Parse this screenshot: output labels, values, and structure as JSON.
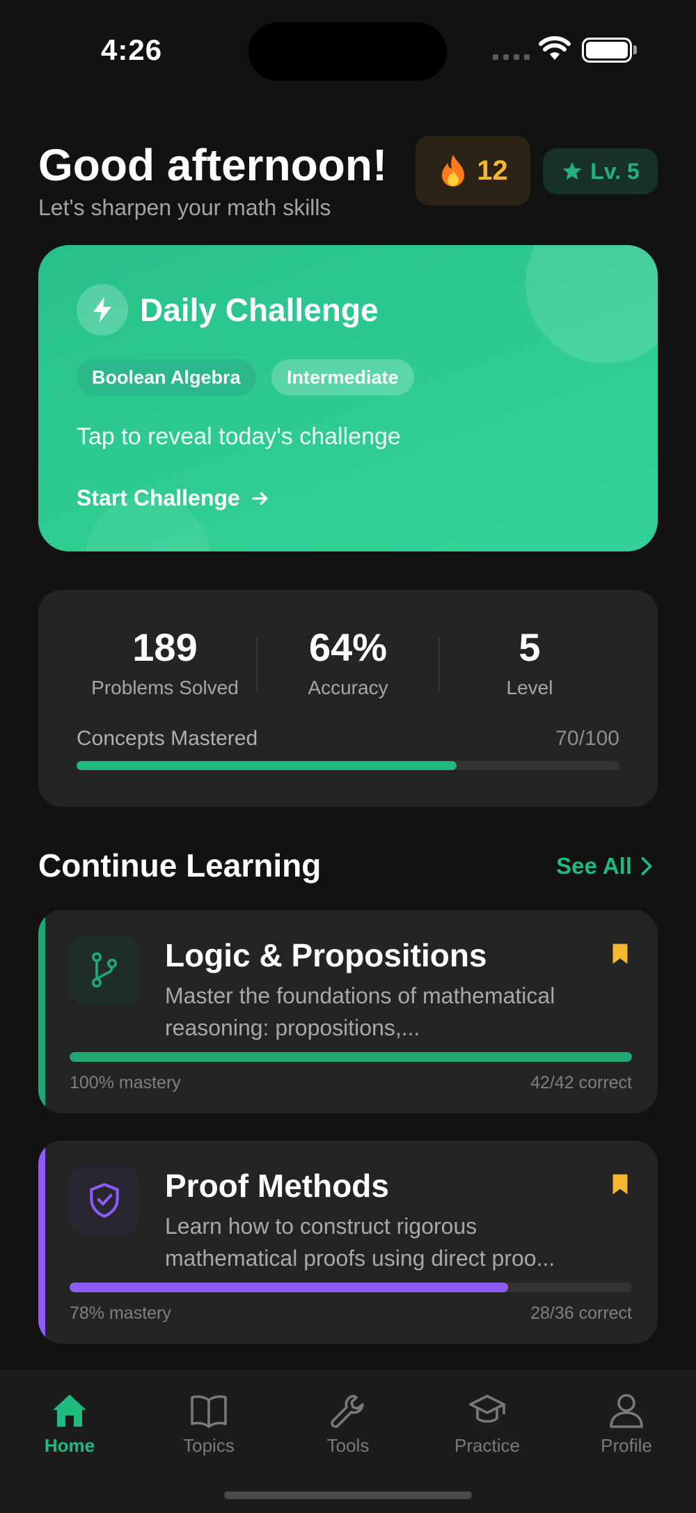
{
  "status": {
    "time": "4:26"
  },
  "header": {
    "greeting": "Good afternoon!",
    "subtitle": "Let's sharpen your math skills",
    "streak": {
      "icon": "fire-icon",
      "value": "12"
    },
    "level": {
      "icon": "star-icon",
      "label": "Lv. 5"
    }
  },
  "challenge": {
    "icon": "lightning-icon",
    "title": "Daily Challenge",
    "topic": "Boolean Algebra",
    "difficulty": "Intermediate",
    "prompt": "Tap to reveal today's challenge",
    "cta": "Start Challenge"
  },
  "stats": {
    "items": [
      {
        "value": "189",
        "label": "Problems Solved"
      },
      {
        "value": "64%",
        "label": "Accuracy"
      },
      {
        "value": "5",
        "label": "Level"
      }
    ],
    "concepts_label": "Concepts Mastered",
    "concepts_count": "70/100",
    "concepts_progress": 0.7
  },
  "continue_learning": {
    "title": "Continue Learning",
    "see_all": "See All",
    "courses": [
      {
        "icon": "branch-icon",
        "title": "Logic & Propositions",
        "description": "Master the foundations of mathematical reasoning: propositions,...",
        "mastery": "100% mastery",
        "correct": "42/42 correct",
        "progress": 1.0,
        "color": "#1fa874"
      },
      {
        "icon": "shield-check-icon",
        "title": "Proof Methods",
        "description": "Learn how to construct rigorous mathematical proofs using direct proo...",
        "mastery": "78% mastery",
        "correct": "28/36 correct",
        "progress": 0.78,
        "color": "#8b5cf6"
      }
    ]
  },
  "tabs": [
    {
      "label": "Home",
      "icon": "home-icon",
      "active": true
    },
    {
      "label": "Topics",
      "icon": "book-icon",
      "active": false
    },
    {
      "label": "Tools",
      "icon": "wrench-icon",
      "active": false
    },
    {
      "label": "Practice",
      "icon": "graduation-cap-icon",
      "active": false
    },
    {
      "label": "Profile",
      "icon": "person-icon",
      "active": false
    }
  ],
  "colors": {
    "accent": "#1fba7e",
    "streak": "#f5b82e",
    "bookmark": "#f5b82e"
  }
}
